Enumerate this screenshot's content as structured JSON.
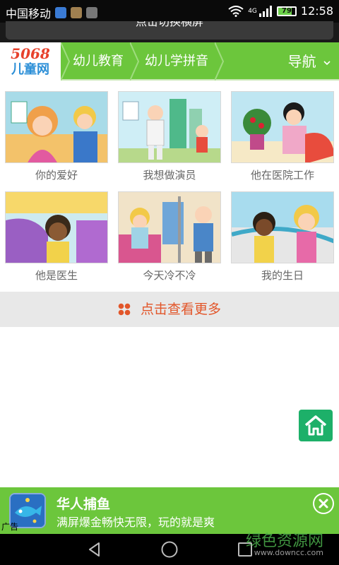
{
  "status_bar": {
    "carrier": "中国移动",
    "network": "4G",
    "battery": "79",
    "time": "12:58"
  },
  "rotate_button_label": "点击切换横屏",
  "nav": {
    "logo_number": "5068",
    "logo_text": "儿童网",
    "breadcrumb": [
      "幼儿教育",
      "幼儿学拼音"
    ],
    "menu_label": "导航"
  },
  "cards": [
    {
      "caption": "你的爱好"
    },
    {
      "caption": "我想做演员"
    },
    {
      "caption": "他在医院工作"
    },
    {
      "caption": "他是医生"
    },
    {
      "caption": "今天冷不冷"
    },
    {
      "caption": "我的生日"
    }
  ],
  "more_label": "点击查看更多",
  "ad": {
    "title": "华人捕鱼",
    "description": "满屏爆金畅快无限，玩的就是爽",
    "label": "广告"
  },
  "watermark": {
    "text": "绿色资源网",
    "url": "www.downcc.com"
  },
  "colors": {
    "brand_green": "#6cc63c",
    "home_button": "#1db069",
    "more_accent": "#e2562a"
  }
}
